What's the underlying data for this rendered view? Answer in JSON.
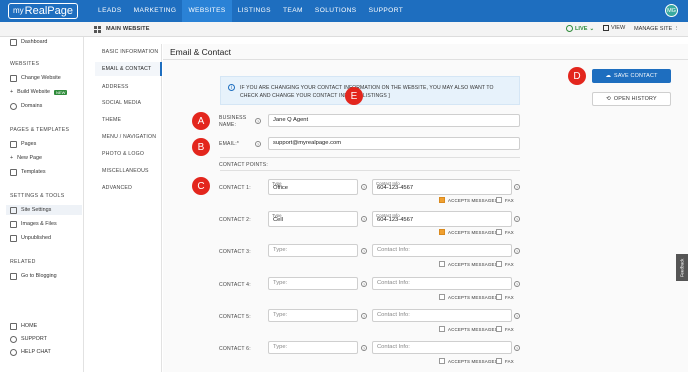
{
  "brand": {
    "my": "my",
    "name": "RealPage"
  },
  "top_nav": [
    "LEADS",
    "MARKETING",
    "WEBSITES",
    "LISTINGS",
    "TEAM",
    "SOLUTIONS",
    "SUPPORT"
  ],
  "user_initials": "MG",
  "site_bar": {
    "site": "MAIN WEBSITE",
    "status": "LIVE",
    "view": "VIEW",
    "manage": "MANAGE SITE"
  },
  "sidebar": {
    "dashboard": "Dashboard",
    "websites_head": "WEBSITES",
    "change_website": "Change Website",
    "build_website": "Build Website",
    "new_badge": "NEW",
    "domains": "Domains",
    "pages_head": "PAGES & TEMPLATES",
    "pages": "Pages",
    "new_page": "New Page",
    "templates": "Templates",
    "settings_head": "SETTINGS & TOOLS",
    "site_settings": "Site Settings",
    "images_files": "Images & Files",
    "unpublished": "Unpublished",
    "related_head": "RELATED",
    "go_blogging": "Go to Blogging",
    "home": "HOME",
    "support": "SUPPORT",
    "help_chat": "HELP CHAT"
  },
  "settings_nav": [
    "BASIC INFORMATION",
    "EMAIL & CONTACT",
    "ADDRESS",
    "SOCIAL MEDIA",
    "THEME",
    "MENU / NAVIGATION",
    "PHOTO & LOGO",
    "MISCELLANEOUS",
    "ADVANCED"
  ],
  "page_title": "Email & Contact",
  "info_text": "IF YOU ARE CHANGING YOUR CONTACT INFORMATION ON THE WEBSITE, YOU MAY ALSO WANT TO CHECK AND CHANGE YOUR CONTACT INFO IN [ LISTINGS ]",
  "form": {
    "business_name_label": "BUSINESS NAME:",
    "business_name": "Jane Q Agent",
    "email_label": "EMAIL:*",
    "email": "support@myrealpage.com",
    "contact_points_label": "CONTACT POINTS:",
    "type_caption": "Type",
    "info_caption": "Contact Info",
    "type_placeholder": "Type:",
    "info_placeholder": "Contact Info:",
    "accepts_label": "ACCEPTS MESSAGES",
    "fax_label": "FAX",
    "contacts": [
      {
        "label": "CONTACT 1:",
        "type": "Office",
        "info": "604-123-4567",
        "accepts": true,
        "fax": false
      },
      {
        "label": "CONTACT 2:",
        "type": "Cell",
        "info": "604-123-4567",
        "accepts": true,
        "fax": false
      },
      {
        "label": "CONTACT 3:",
        "type": "",
        "info": "",
        "accepts": false,
        "fax": false
      },
      {
        "label": "CONTACT 4:",
        "type": "",
        "info": "",
        "accepts": false,
        "fax": false
      },
      {
        "label": "CONTACT 5:",
        "type": "",
        "info": "",
        "accepts": false,
        "fax": false
      },
      {
        "label": "CONTACT 6:",
        "type": "",
        "info": "",
        "accepts": false,
        "fax": false
      }
    ]
  },
  "buttons": {
    "save": "SAVE CONTACT",
    "history": "OPEN HISTORY"
  },
  "feedback": "Feedback",
  "markers": [
    "A",
    "B",
    "C",
    "D",
    "E"
  ],
  "colors": {
    "brand_blue": "#1e6ebf",
    "marker_red": "#e3261d",
    "checkbox_orange": "#f0a030",
    "live_green": "#2e8b3a"
  }
}
